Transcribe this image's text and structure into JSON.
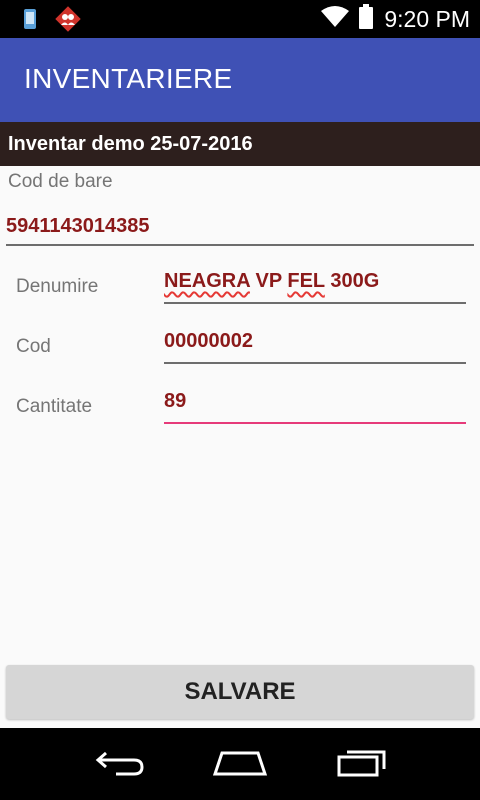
{
  "status_bar": {
    "time": "9:20 PM",
    "icons": [
      "phone-notification-icon",
      "app-notification-icon",
      "wifi-icon",
      "battery-icon"
    ]
  },
  "app_bar": {
    "title": "INVENTARIERE",
    "color": "#3f51b5"
  },
  "inventory": {
    "title": "Inventar demo 25-07-2016"
  },
  "barcode": {
    "label": "Cod de bare",
    "value": "5941143014385"
  },
  "fields": {
    "denumire": {
      "label": "Denumire",
      "value_part1": "NEAGRA",
      "value_part2": " VP ",
      "value_part3": "FEL",
      "value_part4": " 300G"
    },
    "cod": {
      "label": "Cod",
      "value": "00000002"
    },
    "cantitate": {
      "label": "Cantitate",
      "value": "89"
    }
  },
  "save_button": {
    "label": "SALVARE"
  },
  "nav_bar": {
    "icons": [
      "back-icon",
      "home-icon",
      "recents-icon"
    ]
  },
  "colors": {
    "value_text": "#8b1a1a",
    "active_underline": "#e63a7a",
    "header_dark": "#2d1f1d"
  }
}
